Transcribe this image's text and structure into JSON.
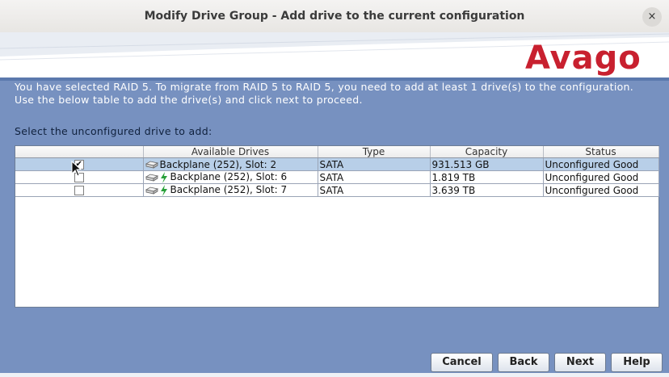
{
  "window": {
    "title": "Modify Drive Group - Add drive to the current configuration",
    "close_label": "×"
  },
  "brand": {
    "logo_text": "Avago",
    "logo_color": "#c8202f"
  },
  "message": "You have selected RAID 5. To migrate from RAID 5 to RAID 5, you need to add at least 1 drive(s) to the configuration.\nUse the below table to add the drive(s) and click next to proceed.",
  "prompt": "Select the unconfigured drive to add:",
  "table": {
    "columns": [
      "",
      "Available Drives",
      "Type",
      "Capacity",
      "Status"
    ],
    "rows": [
      {
        "checked": true,
        "selected": true,
        "drive": "Backplane (252), Slot: 2",
        "type": "SATA",
        "capacity": "931.513 GB",
        "status": "Unconfigured Good",
        "icons": [
          "drive-icon"
        ]
      },
      {
        "checked": false,
        "selected": false,
        "drive": "Backplane (252), Slot: 6",
        "type": "SATA",
        "capacity": "1.819 TB",
        "status": "Unconfigured Good",
        "icons": [
          "drive-icon",
          "lightning-icon"
        ]
      },
      {
        "checked": false,
        "selected": false,
        "drive": "Backplane (252), Slot: 7",
        "type": "SATA",
        "capacity": "3.639 TB",
        "status": "Unconfigured Good",
        "icons": [
          "drive-icon",
          "lightning-icon"
        ]
      }
    ]
  },
  "buttons": {
    "cancel": "Cancel",
    "back": "Back",
    "next": "Next",
    "help": "Help"
  }
}
